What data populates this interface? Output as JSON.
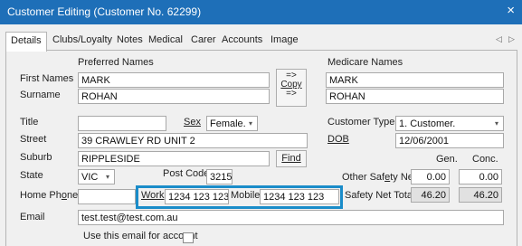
{
  "window": {
    "title": "Customer Editing (Customer No. 62299)",
    "close_glyph": "×"
  },
  "tabs": [
    "Details",
    "Clubs/Loyalty",
    "Notes",
    "Medical",
    "Carer",
    "Accounts",
    "Image"
  ],
  "tab_scroll": {
    "left": "◁",
    "right": "▷"
  },
  "headers": {
    "preferred": "Preferred Names",
    "medicare": "Medicare Names"
  },
  "labels": {
    "first_names": "First Names",
    "surname": "Surname",
    "title": "Title",
    "sex": "Sex",
    "street": "Street",
    "suburb": "Suburb",
    "state": "State",
    "post_code": "Post Code",
    "home_phone": "Home Phone",
    "work": "Work",
    "mobile": "Mobile",
    "email": "Email",
    "customer_type": "Customer Type",
    "dob": "DOB",
    "gen": "Gen.",
    "conc": "Conc.",
    "other_safety_net": "Other Safety Net",
    "safety_net_total": "Safety Net Total",
    "use_email": "Use this email for account"
  },
  "values": {
    "first_name": "MARK",
    "surname": "ROHAN",
    "medicare_first": "MARK",
    "medicare_surname": "ROHAN",
    "title": "",
    "sex": "Female.",
    "street": "39 CRAWLEY RD UNIT 2",
    "suburb": "RIPPLESIDE",
    "state": "VIC",
    "post_code": "3215",
    "home_phone": "",
    "work_phone": "1234 123 123",
    "mobile_phone": "1234 123 123",
    "email": "test.test@test.com.au",
    "customer_type": "1. Customer.",
    "dob": "12/06/2001",
    "other_safety_gen": "0.00",
    "other_safety_conc": "0.00",
    "safety_total_gen": "46.20",
    "safety_total_conc": "46.20"
  },
  "buttons": {
    "copy_arrow_top": "=>",
    "copy": "Copy",
    "copy_arrow_bottom": "=>",
    "find": "Find"
  },
  "dropdown_glyph": "▾",
  "accent_color": "#1a8cc9",
  "titlebar_color": "#1e6fb8"
}
